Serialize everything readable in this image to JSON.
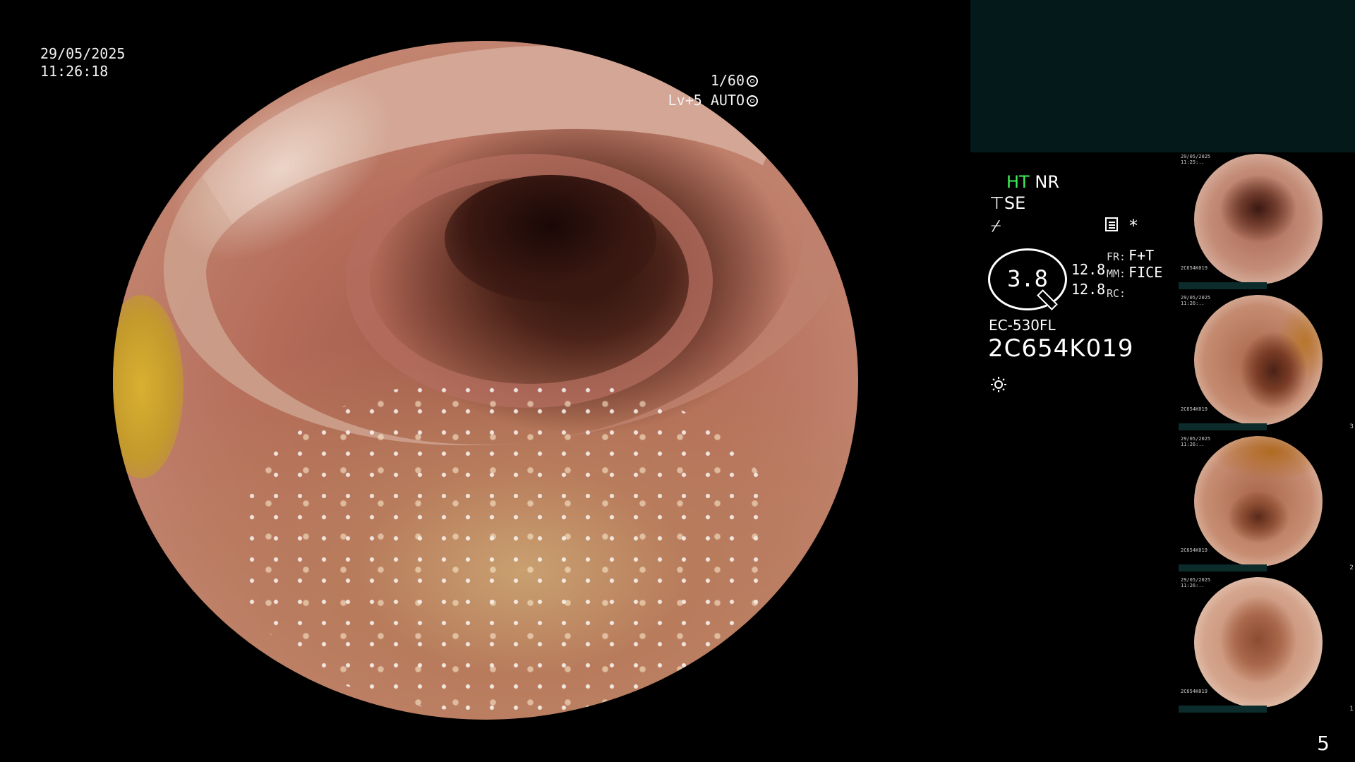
{
  "timestamp": {
    "date": "29/05/2025",
    "time": "11:26:18"
  },
  "shutter": {
    "speed": "1/60",
    "level": "Lv+5 AUTO"
  },
  "status": {
    "ht": "HT",
    "nr": "NR",
    "se": "SE",
    "signal_glyph": "⌿",
    "star": "*",
    "gauge_value": "3.8",
    "val1": "12.8",
    "val2": "12.8",
    "fr_label": "FR:",
    "fr_value": "F+T",
    "mm_label": "MM:",
    "mm_value": "FICE",
    "rc_label": "RC:",
    "rc_value": ""
  },
  "scope": {
    "model": "EC-530FL",
    "serial": "2C654K019"
  },
  "thumbnails": [
    {
      "tl": "29/05/2025\n11:25:..",
      "serial": "2C654K019",
      "idx": ""
    },
    {
      "tl": "29/05/2025\n11:26:..",
      "serial": "2C654K019",
      "idx": "3"
    },
    {
      "tl": "29/05/2025\n11:26:..",
      "serial": "2C654K019",
      "idx": "2"
    },
    {
      "tl": "29/05/2025\n11:26:..",
      "serial": "2C654K019",
      "idx": "1"
    }
  ],
  "page_number": "5",
  "colors": {
    "panel_teal": "#03191a",
    "ht_green": "#3df05a",
    "background": "#000000"
  }
}
